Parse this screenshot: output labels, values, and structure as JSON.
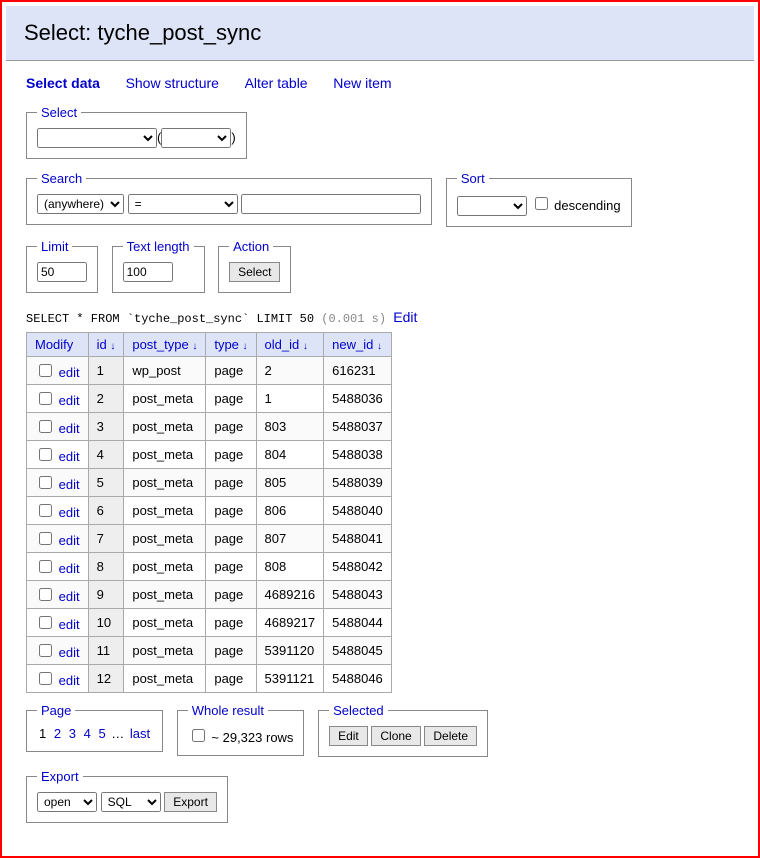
{
  "header": {
    "prefix": "Select: ",
    "table": "tyche_post_sync"
  },
  "tabs": [
    "Select data",
    "Show structure",
    "Alter table",
    "New item"
  ],
  "select": {
    "legend": "Select"
  },
  "search": {
    "legend": "Search",
    "column_value": "(anywhere)",
    "operator_value": "="
  },
  "sort": {
    "legend": "Sort",
    "desc_label": "descending"
  },
  "limit": {
    "legend": "Limit",
    "value": "50"
  },
  "textlength": {
    "legend": "Text length",
    "value": "100"
  },
  "action": {
    "legend": "Action",
    "button": "Select"
  },
  "sql": {
    "query": "SELECT * FROM `tyche_post_sync` LIMIT 50",
    "time": "(0.001 s)",
    "edit": "Edit"
  },
  "table": {
    "columns": [
      "Modify",
      "id",
      "post_type",
      "type",
      "old_id",
      "new_id"
    ],
    "edit_label": "edit",
    "rows": [
      {
        "id": "1",
        "post_type": "wp_post",
        "type": "page",
        "old_id": "2",
        "new_id": "616231"
      },
      {
        "id": "2",
        "post_type": "post_meta",
        "type": "page",
        "old_id": "1",
        "new_id": "5488036"
      },
      {
        "id": "3",
        "post_type": "post_meta",
        "type": "page",
        "old_id": "803",
        "new_id": "5488037"
      },
      {
        "id": "4",
        "post_type": "post_meta",
        "type": "page",
        "old_id": "804",
        "new_id": "5488038"
      },
      {
        "id": "5",
        "post_type": "post_meta",
        "type": "page",
        "old_id": "805",
        "new_id": "5488039"
      },
      {
        "id": "6",
        "post_type": "post_meta",
        "type": "page",
        "old_id": "806",
        "new_id": "5488040"
      },
      {
        "id": "7",
        "post_type": "post_meta",
        "type": "page",
        "old_id": "807",
        "new_id": "5488041"
      },
      {
        "id": "8",
        "post_type": "post_meta",
        "type": "page",
        "old_id": "808",
        "new_id": "5488042"
      },
      {
        "id": "9",
        "post_type": "post_meta",
        "type": "page",
        "old_id": "4689216",
        "new_id": "5488043"
      },
      {
        "id": "10",
        "post_type": "post_meta",
        "type": "page",
        "old_id": "4689217",
        "new_id": "5488044"
      },
      {
        "id": "11",
        "post_type": "post_meta",
        "type": "page",
        "old_id": "5391120",
        "new_id": "5488045"
      },
      {
        "id": "12",
        "post_type": "post_meta",
        "type": "page",
        "old_id": "5391121",
        "new_id": "5488046"
      }
    ]
  },
  "page": {
    "legend": "Page",
    "current": "1",
    "links": [
      "2",
      "3",
      "4",
      "5"
    ],
    "last": "last"
  },
  "whole": {
    "legend": "Whole result",
    "text": "~ 29,323 rows"
  },
  "selected": {
    "legend": "Selected",
    "edit": "Edit",
    "clone": "Clone",
    "delete": "Delete"
  },
  "exportf": {
    "legend": "Export",
    "output": "open",
    "format": "SQL",
    "button": "Export"
  }
}
